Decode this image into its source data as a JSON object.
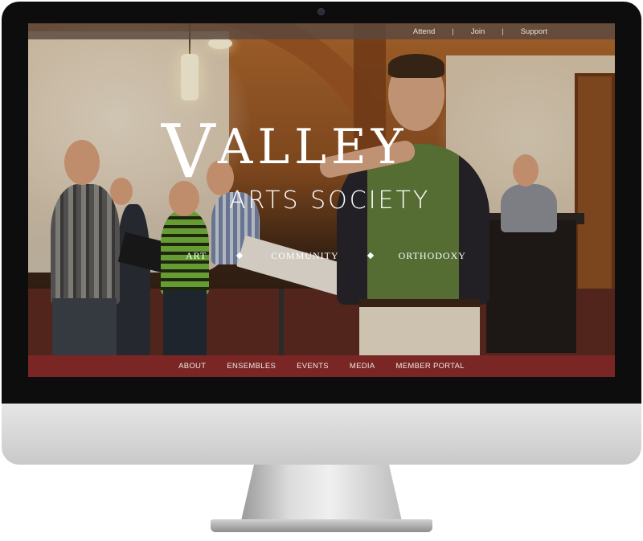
{
  "top_nav": {
    "items": [
      "Attend",
      "Join",
      "Support"
    ],
    "separator": "|"
  },
  "logo": {
    "big_letter": "V",
    "word_rest": "ALLEY",
    "subtitle": "ARTS SOCIETY"
  },
  "tagline": {
    "items": [
      "ART",
      "COMMUNITY",
      "ORTHODOXY"
    ]
  },
  "bottom_nav": {
    "items": [
      "ABOUT",
      "ENSEMBLES",
      "EVENTS",
      "MEDIA",
      "MEMBER PORTAL"
    ]
  },
  "colors": {
    "brand_red": "#7a2624",
    "top_bar": "#5a483e",
    "text_light": "#ffffff"
  }
}
